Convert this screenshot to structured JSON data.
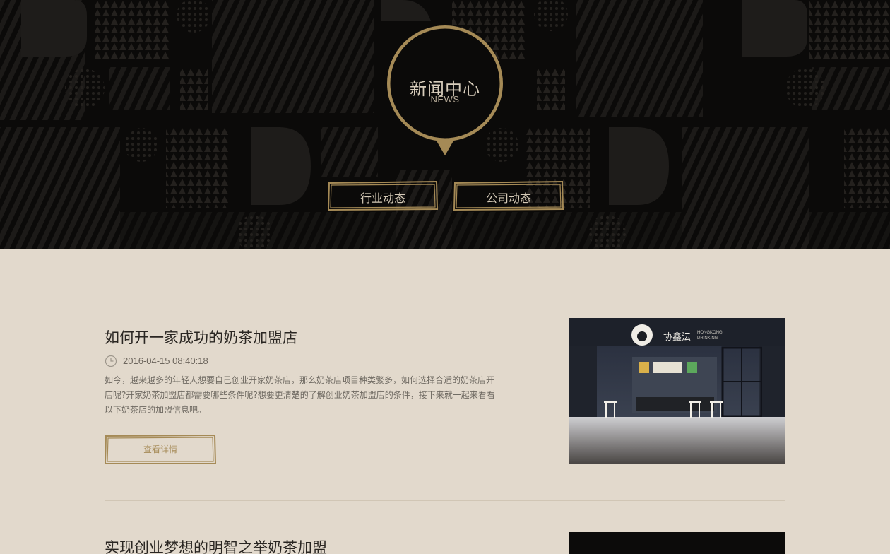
{
  "hero": {
    "title": "新闻中心",
    "subtitle": "NEWS",
    "categories": [
      {
        "label": "行业动态"
      },
      {
        "label": "公司动态"
      }
    ]
  },
  "colors": {
    "gold": "#a58a56",
    "hero_bg": "#0b0a09",
    "content_bg": "#e2d9cc"
  },
  "articles": [
    {
      "title": "如何开一家成功的奶茶加盟店",
      "date": "2016-04-15 08:40:18",
      "excerpt": "如今，越来越多的年轻人想要自己创业开家奶茶店，那么奶茶店项目种类繁多，如何选择合适的奶茶店开店呢?开家奶茶加盟店都需要哪些条件呢?想要更清楚的了解创业奶茶加盟店的条件，接下来就一起来看看以下奶茶店的加盟信息吧。",
      "button_label": "查看详情",
      "image_sign": "协鑫沄",
      "image_sign_en_1": "HONGKONG",
      "image_sign_en_2": "DRINKING"
    },
    {
      "title": "实现创业梦想的明智之举奶茶加盟"
    }
  ],
  "icons": {
    "clock": "clock-icon"
  }
}
